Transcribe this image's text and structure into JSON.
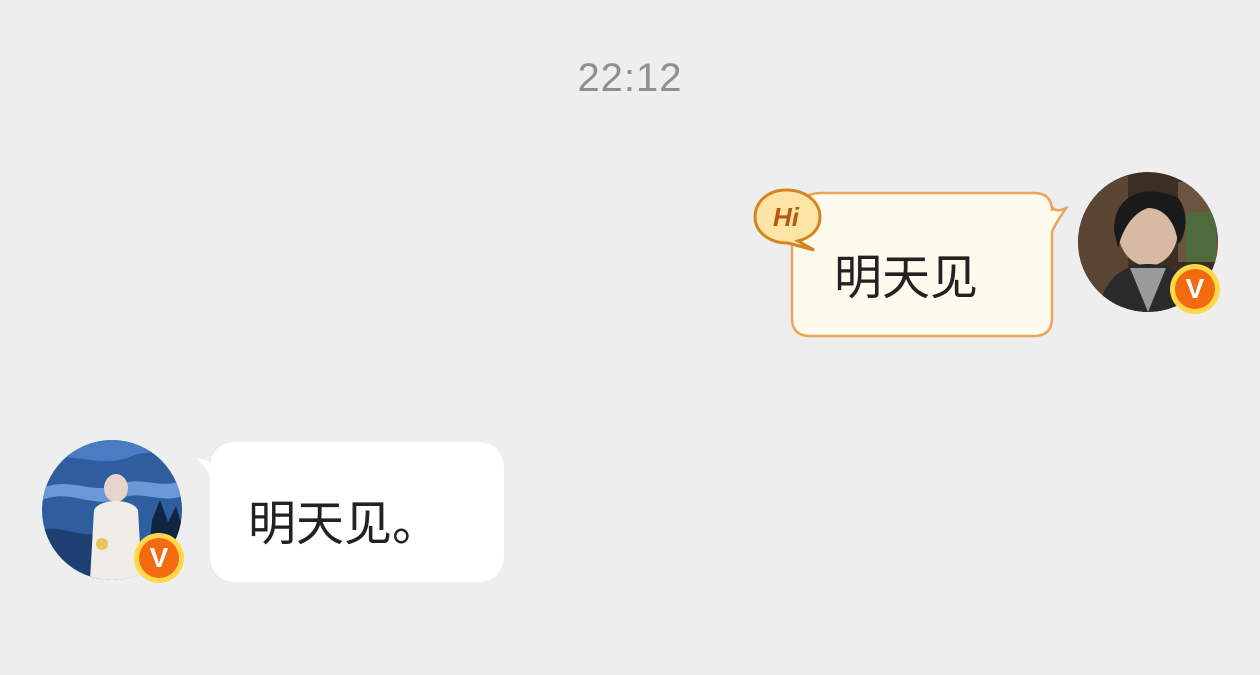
{
  "chat": {
    "timestamp": "22:12",
    "messages": [
      {
        "side": "right",
        "text": "明天见",
        "bubble_style": "hi-sticker-frame"
      },
      {
        "side": "left",
        "text": "明天见。",
        "bubble_style": "plain-white"
      }
    ],
    "sent_badge_label": "Hi",
    "verified_badge_label": "V"
  },
  "colors": {
    "background": "#eeeeee",
    "timestamp": "#8f8f8f",
    "sent_bubble_fill": "#fffaee",
    "sent_bubble_border": "#e9a75a",
    "received_bubble_fill": "#ffffff",
    "verified_badge": "#f46a10"
  },
  "icons": {
    "sent_bubble_decoration": "hi-speech-icon",
    "verified_badge": "verified-v-icon"
  }
}
